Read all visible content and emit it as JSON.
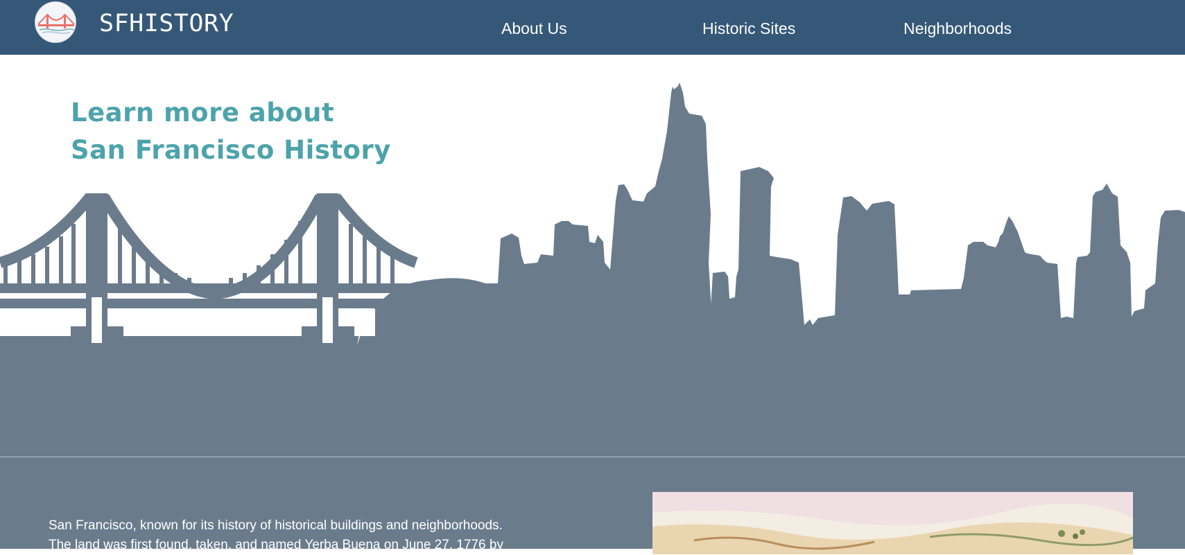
{
  "site": {
    "brand": "SFHISTORY"
  },
  "nav": {
    "items": [
      {
        "label": "About Us"
      },
      {
        "label": "Historic Sites"
      },
      {
        "label": "Neighborhoods"
      }
    ]
  },
  "hero": {
    "line1": "Learn more about",
    "line2": "San Francisco History"
  },
  "about": {
    "line1": "San Francisco, known for its history of historical buildings and neighborhoods.",
    "line2": "The land was first found, taken, and named Yerba Buena on June 27, 1776 by"
  },
  "colors": {
    "nav_bg": "#355878",
    "heading": "#4da3ab",
    "silhouette": "#6a7b8c",
    "logo_bridge": "#e8716c"
  },
  "icons": {
    "logo": "golden-gate-bridge-logo",
    "hero_art": "golden-gate-bridge-and-skyline-silhouette",
    "painting": "watercolor-landscape-painting"
  }
}
